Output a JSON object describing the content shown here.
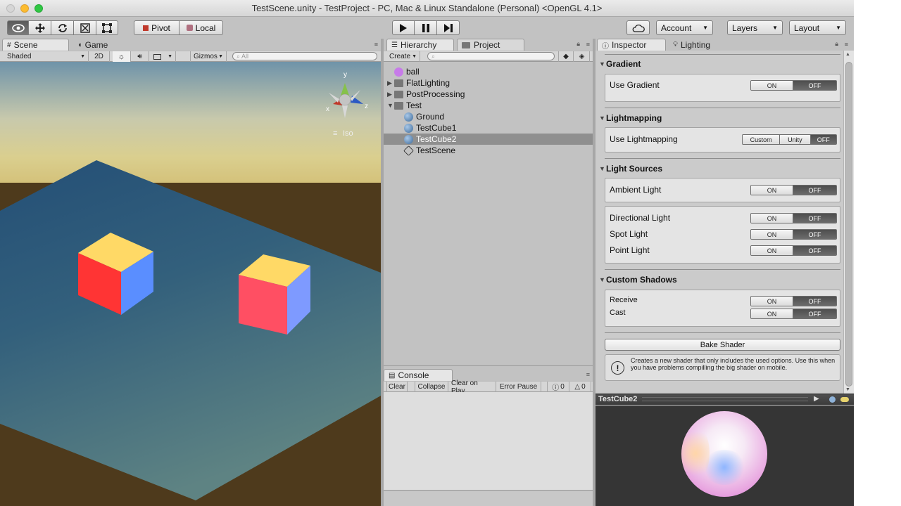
{
  "window": {
    "title": "TestScene.unity - TestProject - PC, Mac & Linux Standalone (Personal) <OpenGL 4.1>"
  },
  "toolbar": {
    "pivot_label": "Pivot",
    "local_label": "Local",
    "account_label": "Account",
    "layers_label": "Layers",
    "layout_label": "Layout"
  },
  "scene": {
    "tabs": [
      "Scene",
      "Game"
    ],
    "shading_mode": "Shaded",
    "mode_2d": "2D",
    "gizmos_label": "Gizmos",
    "search_placeholder": "All",
    "iso_label": "Iso",
    "axes": {
      "x": "x",
      "y": "y",
      "z": "z"
    }
  },
  "hierarchy": {
    "tabs": [
      "Hierarchy",
      "Project"
    ],
    "create_label": "Create",
    "items": [
      {
        "label": "ball",
        "depth": 0,
        "kind": "circle",
        "arrow": ""
      },
      {
        "label": "FlatLighting",
        "depth": 0,
        "kind": "folder",
        "arrow": "▶"
      },
      {
        "label": "PostProcessing",
        "depth": 0,
        "kind": "folder",
        "arrow": "▶"
      },
      {
        "label": "Test",
        "depth": 0,
        "kind": "folder",
        "arrow": "▼"
      },
      {
        "label": "Ground",
        "depth": 1,
        "kind": "sphere",
        "arrow": ""
      },
      {
        "label": "TestCube1",
        "depth": 1,
        "kind": "sphere",
        "arrow": ""
      },
      {
        "label": "TestCube2",
        "depth": 1,
        "kind": "sphere",
        "arrow": "",
        "selected": true
      },
      {
        "label": "TestScene",
        "depth": 1,
        "kind": "unity",
        "arrow": ""
      }
    ]
  },
  "console": {
    "tab": "Console",
    "buttons": [
      "Clear",
      "Collapse",
      "Clear on Play",
      "Error Pause"
    ],
    "warning_count": "0",
    "error_count": "0"
  },
  "inspector": {
    "tabs": [
      "Inspector",
      "Lighting"
    ],
    "sections": {
      "gradient": "Gradient",
      "lightmapping": "Lightmapping",
      "light_sources": "Light Sources",
      "custom_shadows": "Custom Shadows"
    },
    "rows": {
      "use_gradient": "Use Gradient",
      "use_lightmapping": "Use Lightmapping",
      "ambient_light": "Ambient Light",
      "directional_light": "Directional Light",
      "spot_light": "Spot Light",
      "point_light": "Point Light",
      "receive": "Receive",
      "cast": "Cast"
    },
    "toggle_on": "ON",
    "toggle_off": "OFF",
    "lightmap_options": [
      "Custom",
      "Unity",
      "OFF"
    ],
    "lightmap_selected": "OFF",
    "all_toggles_state": "OFF",
    "bake_button": "Bake Shader",
    "help_text": "Creates a new shader that only includes the used options. Use this when you have problems compilling the big shader on mobile."
  },
  "preview": {
    "object_name": "TestCube2"
  }
}
